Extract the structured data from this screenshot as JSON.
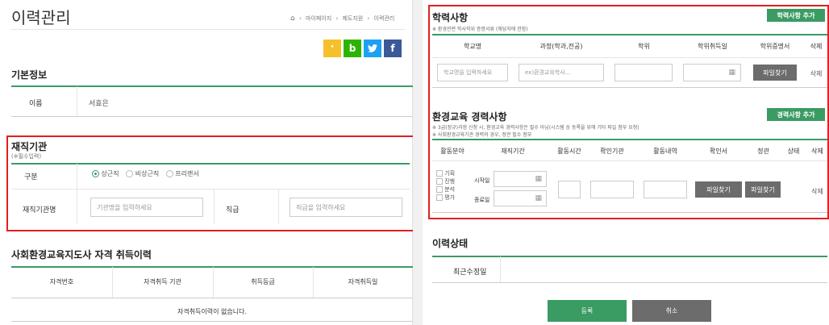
{
  "left": {
    "page_title": "이력관리",
    "breadcrumb": {
      "items": [
        "마이페이지",
        "제도지원",
        "이력관리"
      ]
    },
    "sns": {
      "kakaostory_label": "",
      "blog_label": "b",
      "twitter_label": "",
      "facebook_label": "f",
      "colors": {
        "kakaostory": "#f5c02a",
        "blog": "#2db400",
        "twitter": "#1da1f2",
        "facebook": "#3b5998"
      }
    },
    "basic_info": {
      "title": "기본정보",
      "name_label": "이름",
      "name_value": "서효은"
    },
    "employment": {
      "title": "재직기관",
      "required_note": "(※필수입력)",
      "type_label": "구분",
      "options": [
        "상근직",
        "비상근직",
        "프리랜서"
      ],
      "selected_index": 0,
      "org_label": "재직기관명",
      "org_placeholder": "기관명을 입력하세요",
      "rank_label": "직급",
      "rank_placeholder": "직급을 입력하세요"
    },
    "qualification": {
      "title": "사회환경교육지도사 자격 취득이력",
      "columns": [
        "자격번호",
        "자격취득 기관",
        "취득등급",
        "자격취득일"
      ],
      "empty_message": "자격취득이력이 없습니다."
    }
  },
  "right": {
    "education": {
      "title": "학력사항",
      "note": "※ 환경관련 학사학위 증명서류 (해당자에 한함)",
      "add_button": "학력사항 추가",
      "columns": [
        "학교명",
        "과정(학과,전공)",
        "학위",
        "학위취득일",
        "학위증명서",
        "삭제"
      ],
      "school_placeholder": "학교명을 입력하세요",
      "course_placeholder": "ex)환경교육학사...",
      "file_button": "파일찾기",
      "delete_label": "삭제"
    },
    "career": {
      "title": "환경교육 경력사항",
      "notes": [
        "※ 3급(정규)과정 신청 시, 환경교육 경력사항은 필수 아님(시스템 상 등록을 위해 기타 파일 첨부 요청)",
        "※ 사회환경교육기관 경력의 경우, 정관 필수 첨부"
      ],
      "add_button": "경력사항 추가",
      "columns": [
        "활동분야",
        "재직기간",
        "활동시간",
        "확인기관",
        "활동내역",
        "확인서",
        "정관",
        "상태",
        "삭제"
      ],
      "fields": [
        "기획",
        "진행",
        "분석",
        "평가"
      ],
      "start_label": "시작일",
      "end_label": "종료일",
      "file_button_1": "파일찾기",
      "file_button_2": "파일찾기",
      "delete_label": "삭제"
    },
    "status": {
      "title": "이력상태",
      "last_modified_label": "최근수정일",
      "last_modified_value": ""
    },
    "actions": {
      "register": "등록",
      "cancel": "취소"
    }
  },
  "colors": {
    "accent": "#3a9b63",
    "highlight": "#e02020",
    "grey_button": "#6c6c6c"
  }
}
